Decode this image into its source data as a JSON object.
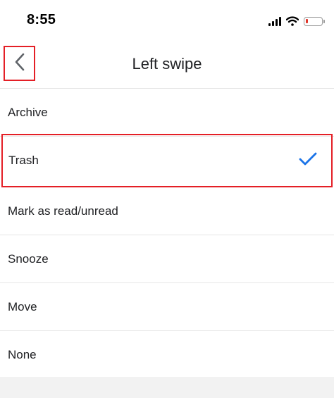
{
  "status_bar": {
    "time": "8:55",
    "icons": [
      "signal-icon",
      "wifi-icon",
      "battery-low-icon"
    ]
  },
  "header": {
    "title": "Left swipe",
    "back_icon": "chevron-left-icon"
  },
  "options": [
    {
      "label": "Archive",
      "selected": false
    },
    {
      "label": "Trash",
      "selected": true
    },
    {
      "label": "Mark as read/unread",
      "selected": false
    },
    {
      "label": "Snooze",
      "selected": false
    },
    {
      "label": "Move",
      "selected": false
    },
    {
      "label": "None",
      "selected": false
    }
  ],
  "colors": {
    "accent_check": "#1a73e8",
    "highlight_box": "#e41f26",
    "battery_low": "#e0352a",
    "text": "#202124"
  }
}
